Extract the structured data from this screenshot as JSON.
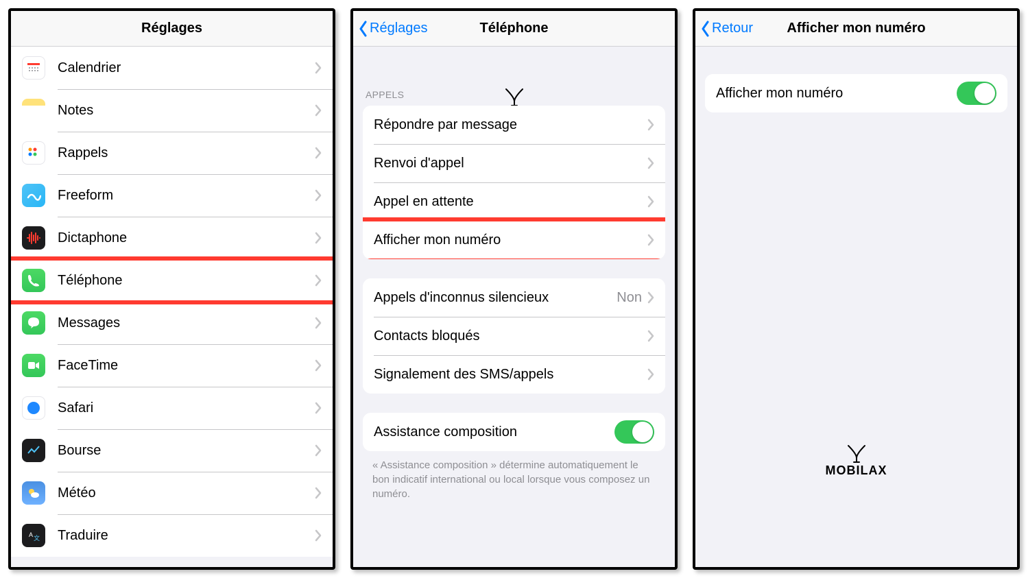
{
  "logo_text": "MOBILAX",
  "panel1": {
    "title": "Réglages",
    "items": [
      {
        "key": "calendar",
        "label": "Calendrier",
        "icon": "calendar-icon",
        "bg": "ic-calendar"
      },
      {
        "key": "notes",
        "label": "Notes",
        "icon": "notes-icon",
        "bg": "ic-notes"
      },
      {
        "key": "reminders",
        "label": "Rappels",
        "icon": "reminders-icon",
        "bg": "ic-reminders"
      },
      {
        "key": "freeform",
        "label": "Freeform",
        "icon": "freeform-icon",
        "bg": "ic-freeform"
      },
      {
        "key": "voicememo",
        "label": "Dictaphone",
        "icon": "voicememo-icon",
        "bg": "ic-voicememo"
      },
      {
        "key": "phone",
        "label": "Téléphone",
        "icon": "phone-icon",
        "bg": "ic-phone",
        "highlight": true
      },
      {
        "key": "messages",
        "label": "Messages",
        "icon": "messages-icon",
        "bg": "ic-messages"
      },
      {
        "key": "facetime",
        "label": "FaceTime",
        "icon": "facetime-icon",
        "bg": "ic-facetime"
      },
      {
        "key": "safari",
        "label": "Safari",
        "icon": "safari-icon",
        "bg": "ic-safari"
      },
      {
        "key": "stocks",
        "label": "Bourse",
        "icon": "stocks-icon",
        "bg": "ic-stocks"
      },
      {
        "key": "weather",
        "label": "Météo",
        "icon": "weather-icon",
        "bg": "ic-weather"
      },
      {
        "key": "translate",
        "label": "Traduire",
        "icon": "translate-icon",
        "bg": "ic-translate"
      }
    ]
  },
  "panel2": {
    "back": "Réglages",
    "title": "Téléphone",
    "section_appels": "Appels",
    "group1": [
      {
        "key": "respond",
        "label": "Répondre par message"
      },
      {
        "key": "forward",
        "label": "Renvoi d'appel"
      },
      {
        "key": "waiting",
        "label": "Appel en attente"
      },
      {
        "key": "showid",
        "label": "Afficher mon numéro",
        "highlight": true
      }
    ],
    "group2": [
      {
        "key": "silence",
        "label": "Appels d'inconnus silencieux",
        "value": "Non"
      },
      {
        "key": "blocked",
        "label": "Contacts bloqués"
      },
      {
        "key": "report",
        "label": "Signalement des SMS/appels"
      }
    ],
    "group3": [
      {
        "key": "dialassist",
        "label": "Assistance composition",
        "toggle": true
      }
    ],
    "footer": "« Assistance composition » détermine automatiquement le bon indicatif international ou local lorsque vous composez un numéro."
  },
  "panel3": {
    "back": "Retour",
    "title": "Afficher mon numéro",
    "row_label": "Afficher mon numéro"
  }
}
